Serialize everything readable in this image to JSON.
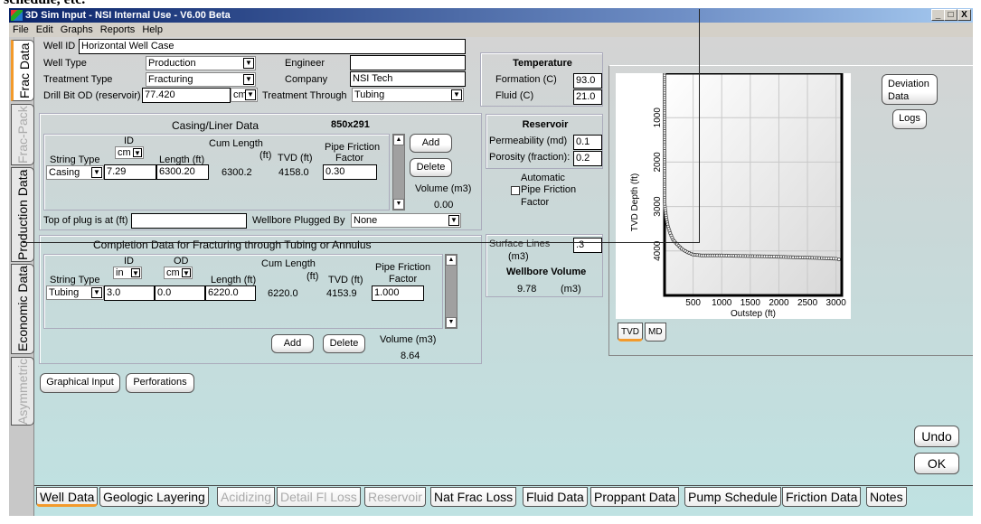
{
  "caption": "schedule, etc.",
  "window": {
    "title": "3D Sim Input - NSI Internal Use - V6.00 Beta",
    "controls": [
      "_",
      "□",
      "X"
    ]
  },
  "menu": [
    "File",
    "Edit",
    "Graphs",
    "Reports",
    "Help"
  ],
  "side_tabs": [
    {
      "label": "Frac Data",
      "state": "active"
    },
    {
      "label": "Frac-Pack",
      "state": "disabled"
    },
    {
      "label": "Production Data",
      "state": "normal"
    },
    {
      "label": "Economic Data",
      "state": "normal"
    },
    {
      "label": "Asymmetric",
      "state": "disabled"
    }
  ],
  "well": {
    "well_id_label": "Well ID",
    "well_id": "Horizontal Well Case",
    "well_type_label": "Well Type",
    "well_type": "Production",
    "engineer_label": "Engineer",
    "engineer": "",
    "treatment_type_label": "Treatment Type",
    "treatment_type": "Fracturing",
    "company_label": "Company",
    "company": "NSI Tech",
    "drill_bit_label": "Drill Bit OD (reservoir)",
    "drill_bit": "77.420",
    "drill_bit_unit": "cm",
    "treatment_through_label": "Treatment Through",
    "treatment_through": "Tubing"
  },
  "casing": {
    "title": "Casing/Liner Data",
    "size_note": "850x291",
    "headers": {
      "string_type": "String Type",
      "id": "ID",
      "id_unit": "cm",
      "length": "Length (ft)",
      "cum_length": "Cum Length",
      "cum_unit": "(ft)",
      "tvd": "TVD (ft)",
      "pff1": "Pipe Friction",
      "pff2": "Factor"
    },
    "row": {
      "string_type": "Casing",
      "id": "7.29",
      "length": "6300.20",
      "cum_length": "6300.2",
      "tvd": "4158.0",
      "pff": "0.30"
    },
    "add": "Add",
    "delete": "Delete",
    "volume_label": "Volume (m3)",
    "volume": "0.00",
    "plug_label": "Top of plug is at (ft)",
    "plug": "",
    "plugged_by_label": "Wellbore Plugged By",
    "plugged_by": "None"
  },
  "completion": {
    "title": "Completion Data for Fracturing through Tubing or Annulus",
    "headers": {
      "string_type": "String Type",
      "id": "ID",
      "id_unit": "in",
      "od": "OD",
      "od_unit": "cm",
      "length": "Length (ft)",
      "cum_length": "Cum Length",
      "cum_unit": "(ft)",
      "tvd": "TVD (ft)",
      "pff1": "Pipe Friction",
      "pff2": "Factor"
    },
    "row": {
      "string_type": "Tubing",
      "id": "3.0",
      "od": "0.0",
      "length": "6220.0",
      "cum_length": "6220.0",
      "tvd": "4153.9",
      "pff": "1.000"
    },
    "add": "Add",
    "delete": "Delete",
    "volume_label": "Volume (m3)",
    "volume": "8.64"
  },
  "buttons": {
    "graphical_input": "Graphical Input",
    "perforations": "Perforations",
    "deviation1": "Deviation",
    "deviation2": "Data",
    "logs": "Logs",
    "undo": "Undo",
    "ok": "OK"
  },
  "temperature": {
    "title": "Temperature",
    "formation_label": "Formation (C)",
    "formation": "93.0",
    "fluid_label": "Fluid (C)",
    "fluid": "21.0"
  },
  "reservoir": {
    "title": "Reservoir",
    "perm_label": "Permeability (md)",
    "perm": "0.1",
    "por_label": "Porosity (fraction):",
    "por": "0.2"
  },
  "auto_pff": {
    "line1": "Automatic",
    "line2": "Pipe Friction",
    "line3": "Factor",
    "checked": false
  },
  "surface": {
    "label1": "Surface Lines",
    "label2": "(m3)",
    "value": ".3",
    "wb_label": "Wellbore Volume",
    "wb_value": "9.78",
    "wb_unit": "(m3)"
  },
  "chart_tabs": [
    {
      "label": "TVD",
      "active": true
    },
    {
      "label": "MD",
      "active": false
    }
  ],
  "chart_data": {
    "type": "scatter",
    "xlabel": "Outstep (ft)",
    "ylabel": "TVD Depth (ft)",
    "xlim": [
      0,
      3100
    ],
    "ylim": [
      0,
      5000
    ],
    "y_inverted": true,
    "grid": true,
    "xticks": [
      "500",
      "1000",
      "1500",
      "2000",
      "2500",
      "3000"
    ],
    "yticks": [
      "1000",
      "2000",
      "3000",
      "4000"
    ],
    "x": [
      0,
      0,
      0,
      0,
      0,
      0,
      0,
      0,
      0,
      0,
      0,
      0,
      0,
      0,
      0,
      0,
      0,
      10,
      30,
      60,
      100,
      150,
      220,
      300,
      400,
      500,
      650,
      800,
      1000,
      1250,
      1500,
      1750,
      2000,
      2250,
      2500,
      2750,
      3000,
      3050
    ],
    "y": [
      0,
      200,
      400,
      600,
      800,
      1000,
      1200,
      1400,
      1600,
      1800,
      2000,
      2200,
      2400,
      2600,
      2700,
      2800,
      2900,
      3050,
      3250,
      3450,
      3600,
      3750,
      3850,
      3950,
      4030,
      4080,
      4100,
      4100,
      4100,
      4110,
      4115,
      4120,
      4130,
      4140,
      4150,
      4160,
      4175,
      4190
    ]
  },
  "bottom_tabs": [
    {
      "label": "Well Data",
      "state": "active"
    },
    {
      "label": "Geologic Layering",
      "state": "normal"
    },
    {
      "label": "Acidizing",
      "state": "disabled"
    },
    {
      "label": "Detail Fl Loss",
      "state": "disabled"
    },
    {
      "label": "Reservoir",
      "state": "disabled"
    },
    {
      "label": "Nat Frac Loss",
      "state": "normal"
    },
    {
      "label": "Fluid Data",
      "state": "normal"
    },
    {
      "label": "Proppant Data",
      "state": "normal"
    },
    {
      "label": "Pump Schedule",
      "state": "normal"
    },
    {
      "label": "Friction Data",
      "state": "normal"
    },
    {
      "label": "Notes",
      "state": "normal"
    }
  ]
}
